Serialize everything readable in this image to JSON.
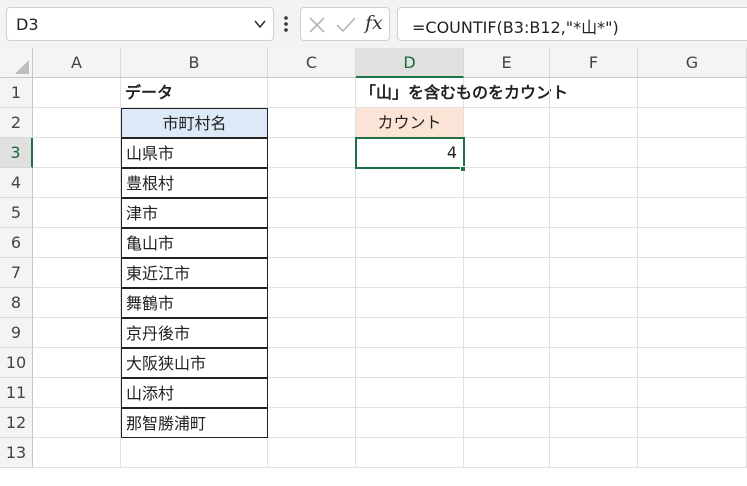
{
  "formula_bar": {
    "name_box": "D3",
    "formula": "=COUNTIF(B3:B12,\"*山*\")"
  },
  "columns": [
    "A",
    "B",
    "C",
    "D",
    "E",
    "F",
    "G"
  ],
  "active_column": "D",
  "rows": [
    "1",
    "2",
    "3",
    "4",
    "5",
    "6",
    "7",
    "8",
    "9",
    "10",
    "11",
    "12",
    "13"
  ],
  "active_row": "3",
  "cells": {
    "B1": "データ",
    "D1": "「山」を含むものをカウント",
    "B2": "市町村名",
    "D2": "カウント",
    "D3": "4"
  },
  "city_list": [
    "山県市",
    "豊根村",
    "津市",
    "亀山市",
    "東近江市",
    "舞鶴市",
    "京丹後市",
    "大阪狭山市",
    "山添村",
    "那智勝浦町"
  ],
  "colors": {
    "selection": "#1e7145",
    "header_blue": "#dce9f6",
    "header_peach": "#fbe3d6"
  }
}
